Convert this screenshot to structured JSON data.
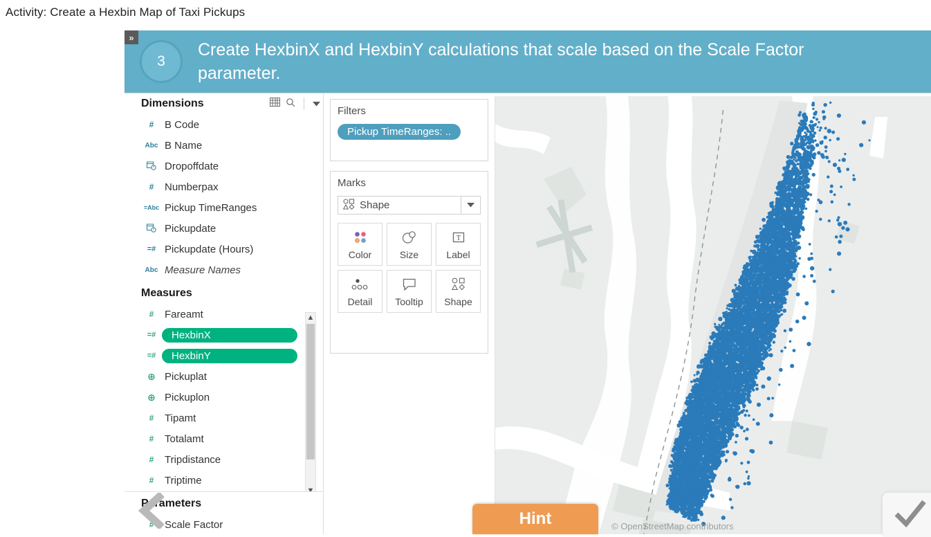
{
  "page": {
    "title": "Activity: Create a Hexbin Map of Taxi Pickups"
  },
  "banner": {
    "collapse_label": "»",
    "step_number": "3",
    "instruction": "Create HexbinX and HexbinY calculations that scale based on the Scale Factor parameter.",
    "background_color": "#62afc9",
    "badge_color": "#6fbad2"
  },
  "data_pane": {
    "dimensions": {
      "header": "Dimensions",
      "icons": [
        "grid-icon",
        "search-icon",
        "chevron-down-icon"
      ],
      "fields": [
        {
          "label": "B Code",
          "icon": "#",
          "type": "number"
        },
        {
          "label": "B Name",
          "icon": "Abc",
          "type": "string"
        },
        {
          "label": "Dropoffdate",
          "icon": "Ὄ5",
          "type": "date"
        },
        {
          "label": "Numberpax",
          "icon": "#",
          "type": "number"
        },
        {
          "label": "Pickup TimeRanges",
          "icon": "=Abc",
          "type": "calculated-string"
        },
        {
          "label": "Pickupdate",
          "icon": "Ὄ5",
          "type": "date"
        },
        {
          "label": "Pickupdate (Hours)",
          "icon": "=#",
          "type": "calculated-number"
        },
        {
          "label": "Measure Names",
          "icon": "Abc",
          "type": "string",
          "italic": true
        }
      ]
    },
    "measures": {
      "header": "Measures",
      "fields": [
        {
          "label": "Fareamt",
          "icon": "#",
          "type": "number",
          "selected": false
        },
        {
          "label": "HexbinX",
          "icon": "=#",
          "type": "calculated-number",
          "selected": true
        },
        {
          "label": "HexbinY",
          "icon": "=#",
          "type": "calculated-number",
          "selected": true
        },
        {
          "label": "Pickuplat",
          "icon": "⊕",
          "type": "geographic",
          "selected": false
        },
        {
          "label": "Pickuplon",
          "icon": "⊕",
          "type": "geographic",
          "selected": false
        },
        {
          "label": "Tipamt",
          "icon": "#",
          "type": "number",
          "selected": false
        },
        {
          "label": "Totalamt",
          "icon": "#",
          "type": "number",
          "selected": false
        },
        {
          "label": "Tripdistance",
          "icon": "#",
          "type": "number",
          "selected": false
        },
        {
          "label": "Triptime",
          "icon": "#",
          "type": "number",
          "selected": false
        }
      ],
      "selected_color": "#00b27f"
    },
    "parameters": {
      "header": "Parameters",
      "fields": [
        {
          "label": "Scale Factor",
          "icon": "#",
          "type": "number"
        }
      ]
    }
  },
  "cards": {
    "filters": {
      "title": "Filters",
      "pills": [
        {
          "label": "Pickup TimeRanges: ..",
          "color": "#4e9fbe"
        }
      ]
    },
    "marks": {
      "title": "Marks",
      "mark_type": "Shape",
      "buttons": [
        {
          "label": "Color",
          "icon": "color-dots-icon"
        },
        {
          "label": "Size",
          "icon": "size-circles-icon"
        },
        {
          "label": "Label",
          "icon": "label-text-icon"
        },
        {
          "label": "Detail",
          "icon": "detail-dots-icon"
        },
        {
          "label": "Tooltip",
          "icon": "tooltip-bubble-icon"
        },
        {
          "label": "Shape",
          "icon": "shape-glyphs-icon"
        }
      ]
    }
  },
  "map": {
    "attribution": "© OpenStreetMap contributors",
    "mark_color": "#2b7bba",
    "base_color": "#ebedec",
    "water_color": "#ffffff"
  },
  "overlays": {
    "hint_button": "Hint",
    "hint_color": "#ef9c52",
    "prev_icon": "chevron-left-icon",
    "confirm_icon": "check-icon"
  }
}
